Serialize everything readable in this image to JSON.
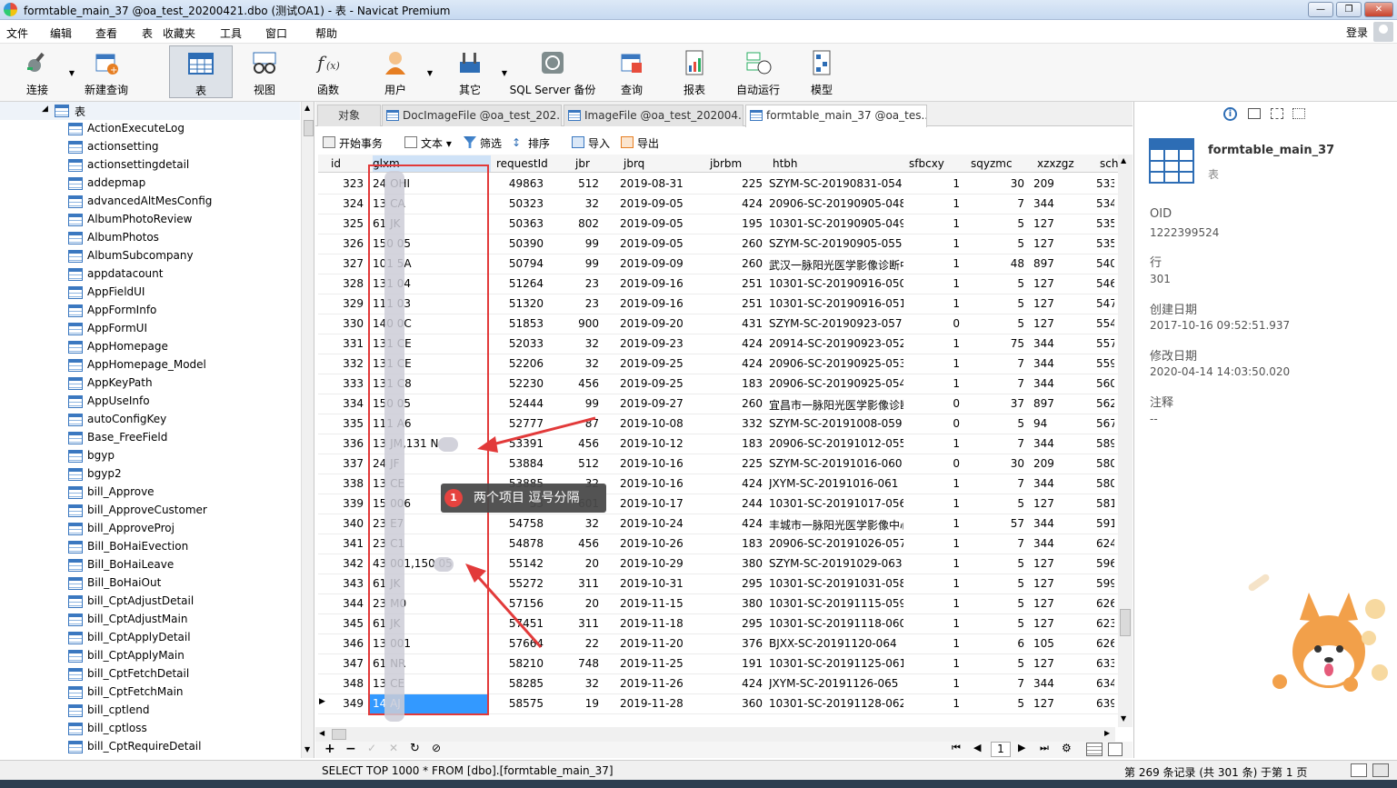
{
  "window": {
    "title": "formtable_main_37 @oa_test_20200421.dbo (测试OA1) - 表 - Navicat Premium"
  },
  "menu": {
    "items": [
      "文件",
      "编辑",
      "查看",
      "表",
      "收藏夹",
      "工具",
      "窗口",
      "帮助"
    ],
    "login": "登录"
  },
  "toolbar": {
    "items": [
      {
        "label": "连接",
        "icon": "plug-icon"
      },
      {
        "label": "新建查询",
        "icon": "new-query-icon"
      },
      {
        "label": "表",
        "icon": "table-icon"
      },
      {
        "label": "视图",
        "icon": "view-icon"
      },
      {
        "label": "函数",
        "icon": "function-icon"
      },
      {
        "label": "用户",
        "icon": "user-icon"
      },
      {
        "label": "其它",
        "icon": "tools-icon"
      },
      {
        "label": "SQL Server 备份",
        "icon": "backup-icon"
      },
      {
        "label": "查询",
        "icon": "query-icon"
      },
      {
        "label": "报表",
        "icon": "report-icon"
      },
      {
        "label": "自动运行",
        "icon": "schedule-icon"
      },
      {
        "label": "模型",
        "icon": "model-icon"
      }
    ]
  },
  "sidebar": {
    "root": "表",
    "items": [
      "ActionExecuteLog",
      "actionsetting",
      "actionsettingdetail",
      "addepmap",
      "advancedAltMesConfig",
      "AlbumPhotoReview",
      "AlbumPhotos",
      "AlbumSubcompany",
      "appdatacount",
      "AppFieldUI",
      "AppFormInfo",
      "AppFormUI",
      "AppHomepage",
      "AppHomepage_Model",
      "AppKeyPath",
      "AppUseInfo",
      "autoConfigKey",
      "Base_FreeField",
      "bgyp",
      "bgyp2",
      "bill_Approve",
      "bill_ApproveCustomer",
      "bill_ApproveProj",
      "Bill_BoHaiEvection",
      "Bill_BoHaiLeave",
      "Bill_BoHaiOut",
      "bill_CptAdjustDetail",
      "bill_CptAdjustMain",
      "bill_CptApplyDetail",
      "bill_CptApplyMain",
      "bill_CptFetchDetail",
      "bill_CptFetchMain",
      "bill_cptlend",
      "bill_cptloss",
      "bill_CptRequireDetail"
    ]
  },
  "tabs": [
    {
      "label": "对象"
    },
    {
      "label": "DocImageFile @oa_test_202..."
    },
    {
      "label": "ImageFile @oa_test_202004..."
    },
    {
      "label": "formtable_main_37 @oa_tes..."
    }
  ],
  "subtoolbar": {
    "begin_tx": "开始事务",
    "text": "文本",
    "filter": "筛选",
    "sort": "排序",
    "import": "导入",
    "export": "导出"
  },
  "grid": {
    "columns": [
      "id",
      "glxm",
      "requestId",
      "jbr",
      "jbrq",
      "jbrbm",
      "htbh",
      "sfbcxy",
      "sqyzmc",
      "xzxzgz",
      "sch"
    ],
    "rows": [
      [
        "323",
        "24 OHI",
        "49863",
        "512",
        "2019-08-31",
        "225",
        "SZYM-SC-20190831-054",
        "1",
        "30",
        "209",
        "533"
      ],
      [
        "324",
        "13 CA",
        "50323",
        "32",
        "2019-09-05",
        "424",
        "20906-SC-20190905-048",
        "1",
        "7",
        "344",
        "534"
      ],
      [
        "325",
        "61 JK",
        "50363",
        "802",
        "2019-09-05",
        "195",
        "10301-SC-20190905-049",
        "1",
        "5",
        "127",
        "535"
      ],
      [
        "326",
        "150 05",
        "50390",
        "99",
        "2019-09-05",
        "260",
        "SZYM-SC-20190905-055",
        "1",
        "5",
        "127",
        "535"
      ],
      [
        "327",
        "101 5A",
        "50794",
        "99",
        "2019-09-09",
        "260",
        "武汉一脉阳光医学影像诊断中",
        "1",
        "48",
        "897",
        "540"
      ],
      [
        "328",
        "131 04",
        "51264",
        "23",
        "2019-09-16",
        "251",
        "10301-SC-20190916-050",
        "1",
        "5",
        "127",
        "546"
      ],
      [
        "329",
        "111 03",
        "51320",
        "23",
        "2019-09-16",
        "251",
        "10301-SC-20190916-051",
        "1",
        "5",
        "127",
        "547"
      ],
      [
        "330",
        "140 0C",
        "51853",
        "900",
        "2019-09-20",
        "431",
        "SZYM-SC-20190923-057",
        "0",
        "5",
        "127",
        "554"
      ],
      [
        "331",
        "131 CE",
        "52033",
        "32",
        "2019-09-23",
        "424",
        "20914-SC-20190923-052",
        "1",
        "75",
        "344",
        "557"
      ],
      [
        "332",
        "131 CE",
        "52206",
        "32",
        "2019-09-25",
        "424",
        "20906-SC-20190925-053",
        "1",
        "7",
        "344",
        "559"
      ],
      [
        "333",
        "131 C8",
        "52230",
        "456",
        "2019-09-25",
        "183",
        "20906-SC-20190925-054",
        "1",
        "7",
        "344",
        "560"
      ],
      [
        "334",
        "150 05",
        "52444",
        "99",
        "2019-09-27",
        "260",
        "宜昌市一脉阳光医学影像诊断",
        "0",
        "37",
        "897",
        "562"
      ],
      [
        "335",
        "111 A6",
        "52777",
        "87",
        "2019-10-08",
        "332",
        "SZYM-SC-20191008-059",
        "0",
        "5",
        "94",
        "567"
      ],
      [
        "336",
        "13 JM,131 N",
        "53391",
        "456",
        "2019-10-12",
        "183",
        "20906-SC-20191012-055",
        "1",
        "7",
        "344",
        "589"
      ],
      [
        "337",
        "24 JF",
        "53884",
        "512",
        "2019-10-16",
        "225",
        "SZYM-SC-20191016-060",
        "0",
        "30",
        "209",
        "580"
      ],
      [
        "338",
        "13 CE",
        "53885",
        "32",
        "2019-10-16",
        "424",
        "JXYM-SC-20191016-061",
        "1",
        "7",
        "344",
        "580"
      ],
      [
        "339",
        "15 006",
        "53",
        "601",
        "2019-10-17",
        "244",
        "10301-SC-20191017-056",
        "1",
        "5",
        "127",
        "581"
      ],
      [
        "340",
        "23 E7",
        "54758",
        "32",
        "2019-10-24",
        "424",
        "丰城市一脉阳光医学影像中心",
        "1",
        "57",
        "344",
        "591"
      ],
      [
        "341",
        "23 C1",
        "54878",
        "456",
        "2019-10-26",
        "183",
        "20906-SC-20191026-057",
        "1",
        "7",
        "344",
        "624"
      ],
      [
        "342",
        "43 001,150 05",
        "55142",
        "20",
        "2019-10-29",
        "380",
        "SZYM-SC-20191029-063",
        "1",
        "5",
        "127",
        "596"
      ],
      [
        "343",
        "61 JK",
        "55272",
        "311",
        "2019-10-31",
        "295",
        "10301-SC-20191031-058",
        "1",
        "5",
        "127",
        "599"
      ],
      [
        "344",
        "23 M0",
        "57156",
        "20",
        "2019-11-15",
        "380",
        "10301-SC-20191115-059",
        "1",
        "5",
        "127",
        "626"
      ],
      [
        "345",
        "61 JK",
        "57451",
        "311",
        "2019-11-18",
        "295",
        "10301-SC-20191118-060",
        "1",
        "5",
        "127",
        "623"
      ],
      [
        "346",
        "13 001",
        "57664",
        "22",
        "2019-11-20",
        "376",
        "BJXX-SC-20191120-064",
        "1",
        "6",
        "105",
        "626"
      ],
      [
        "347",
        "61 NR",
        "58210",
        "748",
        "2019-11-25",
        "191",
        "10301-SC-20191125-061",
        "1",
        "5",
        "127",
        "633"
      ],
      [
        "348",
        "13 CE",
        "58285",
        "32",
        "2019-11-26",
        "424",
        "JXYM-SC-20191126-065",
        "1",
        "7",
        "344",
        "634"
      ],
      [
        "349",
        "14 AJ",
        "58575",
        "19",
        "2019-11-28",
        "360",
        "10301-SC-20191128-062",
        "1",
        "5",
        "127",
        "639"
      ]
    ],
    "page": "1"
  },
  "annotation": {
    "badge": "1",
    "text": "两个项目 逗号分隔"
  },
  "info": {
    "name": "formtable_main_37",
    "type": "表",
    "oid_label": "OID",
    "oid": "1222399524",
    "rows_label": "行",
    "rows": "301",
    "created_label": "创建日期",
    "created": "2017-10-16 09:52:51.937",
    "modified_label": "修改日期",
    "modified": "2020-04-14 14:03:50.020",
    "comment_label": "注释",
    "comment": "--"
  },
  "status": {
    "sql": "SELECT TOP 1000 * FROM [dbo].[formtable_main_37]",
    "records": "第 269 条记录 (共 301 条) 于第 1 页"
  },
  "colors": {
    "accent": "#3399ff",
    "annotation_red": "#e23a3a"
  }
}
